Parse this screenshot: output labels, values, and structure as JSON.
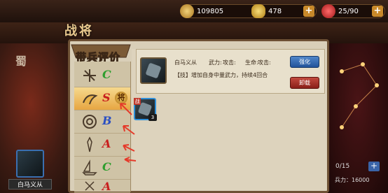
{
  "top": {
    "copper": "109805",
    "ingot": "478",
    "stamina": "25/90",
    "plus": "+"
  },
  "title": "战将",
  "kingdom": "蜀",
  "hero_portrait_label": "白马义从",
  "dialog_title": "带兵评价",
  "troop_rows": [
    {
      "icon": "crossbow-icon",
      "grade": "C",
      "color": "#2e9e2e"
    },
    {
      "icon": "cavalry-icon",
      "grade": "S",
      "color": "#c81e1e",
      "badge": "将"
    },
    {
      "icon": "shield-icon",
      "grade": "B",
      "color": "#2a4fc2"
    },
    {
      "icon": "spear-icon",
      "grade": "A",
      "color": "#c81e1e"
    },
    {
      "icon": "ship-icon",
      "grade": "C",
      "color": "#2e9e2e"
    },
    {
      "icon": "siege-icon",
      "grade": "A",
      "color": "#c81e1e"
    }
  ],
  "skill": {
    "name": "白马义从",
    "stat_war": "武力:",
    "stat_atk": "攻击:",
    "stat_life": "生命:",
    "stat_atk2": "攻击:",
    "desc": "【技】增加自身中量武力，持续4回合",
    "strengthen": "强化",
    "remove": "卸载"
  },
  "inventory": {
    "badge": "战",
    "count": "3"
  },
  "right_panel": {
    "progress": "0/15",
    "troop": "兵力：16000"
  }
}
